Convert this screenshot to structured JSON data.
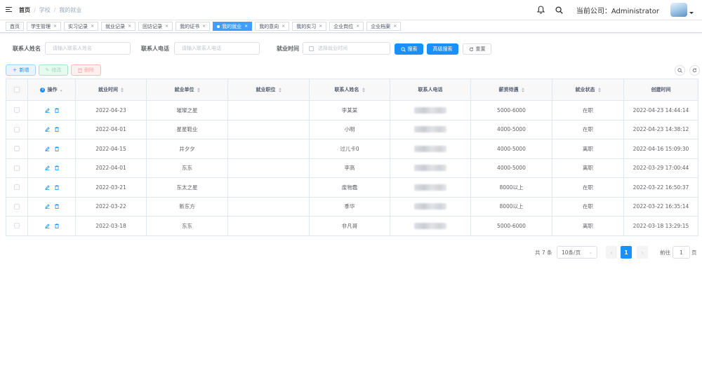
{
  "breadcrumb": [
    "首页",
    "学校",
    "我的就业"
  ],
  "header": {
    "company_label": "当前公司：Administrator"
  },
  "tags": [
    {
      "label": "首页",
      "closable": false,
      "active": false
    },
    {
      "label": "学生管理",
      "closable": true,
      "active": false
    },
    {
      "label": "实习记录",
      "closable": true,
      "active": false
    },
    {
      "label": "就业记录",
      "closable": true,
      "active": false
    },
    {
      "label": "回访记录",
      "closable": true,
      "active": false
    },
    {
      "label": "我的证书",
      "closable": true,
      "active": false
    },
    {
      "label": "我的就业",
      "closable": true,
      "active": true
    },
    {
      "label": "我的意向",
      "closable": true,
      "active": false
    },
    {
      "label": "我的实习",
      "closable": true,
      "active": false
    },
    {
      "label": "企业岗位",
      "closable": true,
      "active": false
    },
    {
      "label": "企业档案",
      "closable": true,
      "active": false
    }
  ],
  "search": {
    "name_label": "联系人姓名",
    "name_placeholder": "请输入联系人姓名",
    "phone_label": "联系人电话",
    "phone_placeholder": "请输入联系人电话",
    "time_label": "就业时间",
    "time_placeholder": "选择就业时间",
    "search_button": "搜索",
    "advanced_button": "高级搜索",
    "reset_button": "重置"
  },
  "toolbar": {
    "add": "新增",
    "edit": "修改",
    "delete": "删除"
  },
  "table": {
    "columns": [
      "操作",
      "就业时间",
      "就业单位",
      "就业职位",
      "联系人姓名",
      "联系人电话",
      "薪资待遇",
      "就业状态",
      "创建时间"
    ],
    "rows": [
      {
        "time": "2022-04-23",
        "unit": "璀璨之星",
        "position": "",
        "contact": "李某某",
        "salary": "5000-6000",
        "status": "在职",
        "created": "2022-04-23 14:44:14"
      },
      {
        "time": "2022-04-01",
        "unit": "星星鞋业",
        "position": "",
        "contact": "小明",
        "salary": "4000-5000",
        "status": "在职",
        "created": "2022-04-23 14:38:12"
      },
      {
        "time": "2022-04-15",
        "unit": "井夕夕",
        "position": "",
        "contact": "过儿卡0",
        "salary": "4000-5000",
        "status": "离职",
        "created": "2022-04-16 15:09:30"
      },
      {
        "time": "2022-04-01",
        "unit": "东东",
        "position": "",
        "contact": "李高",
        "salary": "4000-5000",
        "status": "离职",
        "created": "2022-03-29 17:00:44"
      },
      {
        "time": "2022-03-21",
        "unit": "东太之星",
        "position": "",
        "contact": "废物蠢",
        "salary": "8000以上",
        "status": "在职",
        "created": "2022-03-22 16:50:37"
      },
      {
        "time": "2022-03-22",
        "unit": "新东方",
        "position": "",
        "contact": "季华",
        "salary": "8000以上",
        "status": "在职",
        "created": "2022-03-22 16:35:14"
      },
      {
        "time": "2022-03-18",
        "unit": "东东",
        "position": "",
        "contact": "非凡哥",
        "salary": "5000-6000",
        "status": "离职",
        "created": "2022-03-18 13:29:15"
      }
    ]
  },
  "pagination": {
    "total": "共 7 条",
    "page_size": "10条/页",
    "current_page": "1",
    "goto_label": "前往",
    "goto_value": "1",
    "page_suffix": "页"
  },
  "colors": {
    "primary": "#1890ff",
    "border": "#dfe6ec",
    "header_bg": "#f8f8f9"
  }
}
